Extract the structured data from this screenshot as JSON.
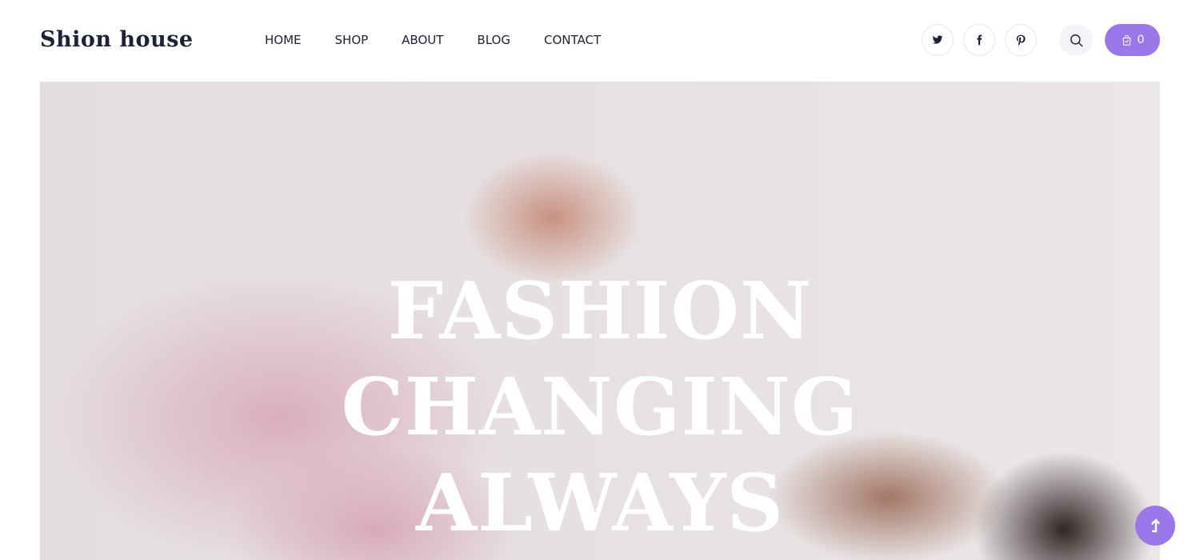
{
  "brand": {
    "logo_text": "Shion house"
  },
  "nav": {
    "items": [
      {
        "label": "HOME"
      },
      {
        "label": "SHOP"
      },
      {
        "label": "ABOUT"
      },
      {
        "label": "BLOG"
      },
      {
        "label": "CONTACT"
      }
    ]
  },
  "social": {
    "icons": [
      "twitter-icon",
      "facebook-icon",
      "pinterest-icon"
    ]
  },
  "search": {
    "icon": "search-icon"
  },
  "cart": {
    "icon": "shopping-bag-icon",
    "count": "0"
  },
  "hero": {
    "lines": [
      "FASHION",
      "CHANGING",
      "ALWAYS"
    ]
  },
  "scroll_top": {
    "icon": "arrow-up-icon"
  },
  "colors": {
    "accent": "#9b78ea",
    "text": "#1e2235",
    "hero_text": "#ffffff"
  }
}
